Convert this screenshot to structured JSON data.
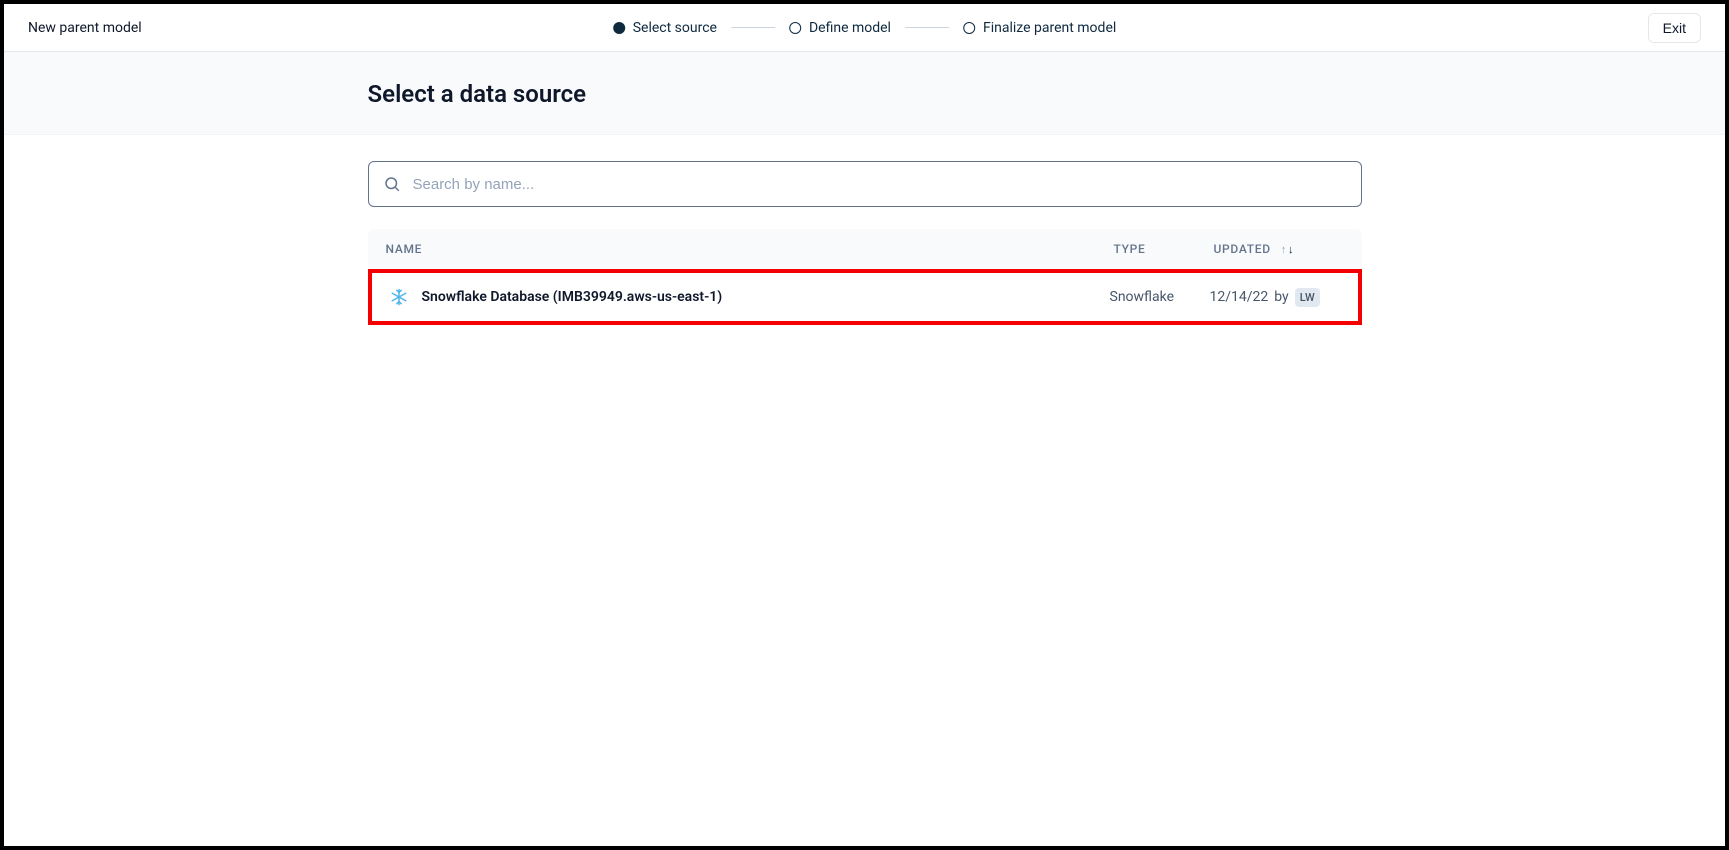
{
  "topbar": {
    "title": "New parent model",
    "exit_label": "Exit"
  },
  "stepper": {
    "steps": [
      {
        "label": "Select source",
        "active": true
      },
      {
        "label": "Define model",
        "active": false
      },
      {
        "label": "Finalize parent model",
        "active": false
      }
    ]
  },
  "page": {
    "title": "Select a data source"
  },
  "search": {
    "placeholder": "Search by name..."
  },
  "table": {
    "headers": {
      "name": "NAME",
      "type": "TYPE",
      "updated": "UPDATED"
    },
    "rows": [
      {
        "icon": "snowflake-icon",
        "name": "Snowflake Database (IMB39949.aws-us-east-1)",
        "type": "Snowflake",
        "updated_date": "12/14/22",
        "updated_by_word": "by",
        "updated_initials": "LW",
        "highlighted": true
      }
    ]
  }
}
